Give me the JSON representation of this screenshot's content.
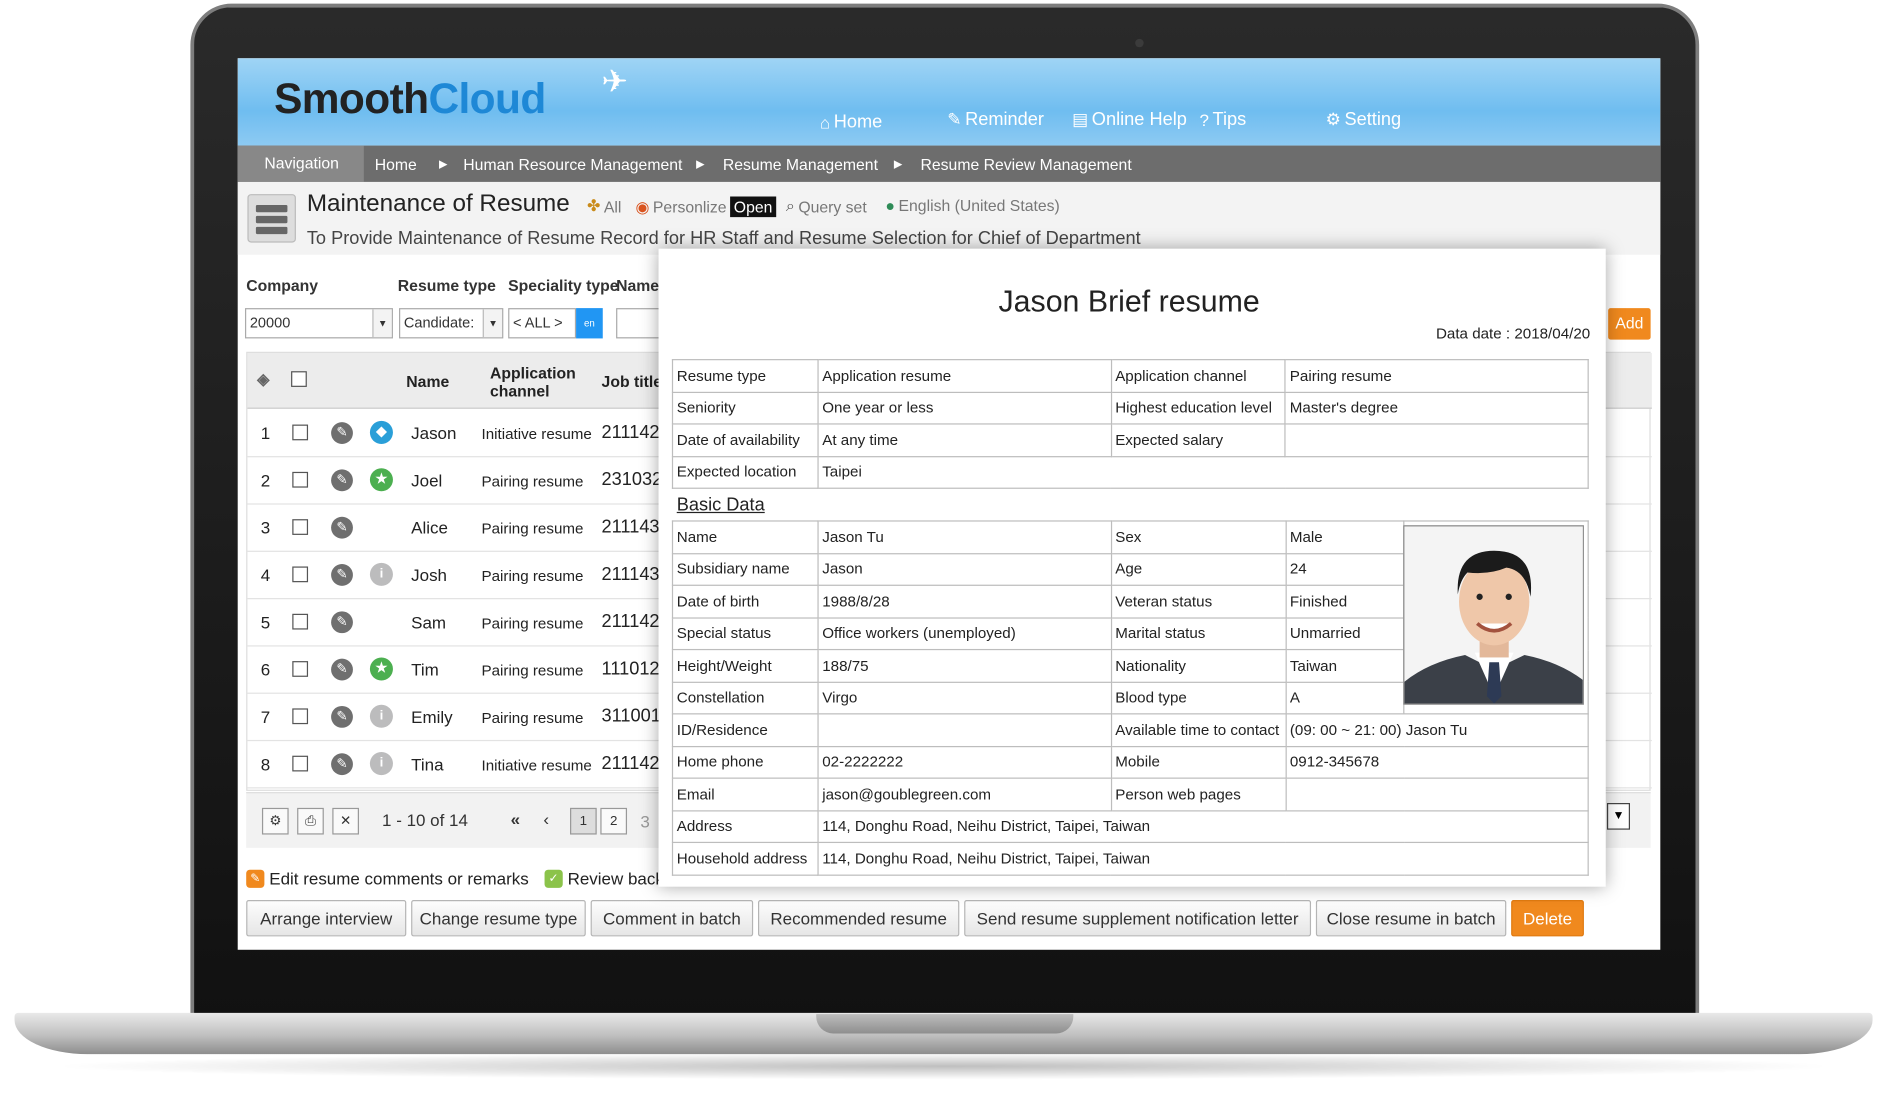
{
  "app": {
    "logo_a": "Smooth",
    "logo_b": "Cloud"
  },
  "nav": {
    "home": "Home",
    "reminder": "Reminder",
    "online_help": "Online Help",
    "tips": "Tips",
    "setting": "Setting"
  },
  "breadcrumb": {
    "navigation": "Navigation",
    "items": [
      "Home",
      "Human Resource Management",
      "Resume Management",
      "Resume Review Management"
    ]
  },
  "page": {
    "title": "Maintenance of Resume",
    "tool_all": "All",
    "tool_personalize": "Personlize",
    "tool_open": "Open",
    "tool_query": "Query set",
    "tool_lang": "English (United States)",
    "description": "To Provide Maintenance of Resume Record for HR Staff and Resume Selection for Chief of Department"
  },
  "filters": {
    "company_label": "Company",
    "company_value": "20000",
    "resume_type_label": "Resume type",
    "resume_type_value": "Candidate:",
    "speciality_label": "Speciality type",
    "speciality_value": "< ALL >",
    "en_badge": "en",
    "name_label": "Name",
    "add_label": "Add"
  },
  "grid": {
    "headers": {
      "name": "Name",
      "channel_1": "Application",
      "channel_2": "channel",
      "job_title": "Job title"
    },
    "rows": [
      {
        "num": "1",
        "name": "Jason",
        "channel": "Initiative resume",
        "job": "211142",
        "status": "tag"
      },
      {
        "num": "2",
        "name": "Joel",
        "channel": "Pairing resume",
        "job": "231032",
        "status": "star"
      },
      {
        "num": "3",
        "name": "Alice",
        "channel": "Pairing resume",
        "job": "211143",
        "status": "none"
      },
      {
        "num": "4",
        "name": "Josh",
        "channel": "Pairing resume",
        "job": "211143",
        "status": "info"
      },
      {
        "num": "5",
        "name": "Sam",
        "channel": "Pairing resume",
        "job": "211142",
        "status": "none"
      },
      {
        "num": "6",
        "name": "Tim",
        "channel": "Pairing resume",
        "job": "111012",
        "status": "star"
      },
      {
        "num": "7",
        "name": "Emily",
        "channel": "Pairing resume",
        "job": "311001",
        "status": "info"
      },
      {
        "num": "8",
        "name": "Tina",
        "channel": "Initiative resume",
        "job": "211142",
        "status": "info"
      }
    ]
  },
  "pager": {
    "range": "1 - 10 of 14",
    "page1": "1",
    "page2": "2",
    "page3": "3"
  },
  "legend": {
    "edit": "Edit resume comments or remarks",
    "review": "Review back"
  },
  "actions": {
    "arrange": "Arrange interview",
    "change": "Change resume type",
    "comment": "Comment in batch",
    "recommended": "Recommended resume",
    "supplement": "Send resume supplement notification letter",
    "close": "Close resume in batch",
    "delete": "Delete"
  },
  "resume": {
    "title": "Jason Brief resume",
    "data_date": "Data date : 2018/04/20",
    "top": [
      [
        "Resume type",
        "Application resume",
        "Application channel",
        "Pairing resume"
      ],
      [
        "Seniority",
        "One year or less",
        "Highest education level",
        "Master's degree"
      ],
      [
        "Date of availability",
        "At any time",
        "Expected salary",
        ""
      ]
    ],
    "expected_location_label": "Expected location",
    "expected_location": "Taipei",
    "basic_data": "Basic Data",
    "basic": [
      [
        "Name",
        "Jason Tu",
        "Sex",
        "Male"
      ],
      [
        "Subsidiary name",
        "Jason",
        "Age",
        "24"
      ],
      [
        "Date of birth",
        "1988/8/28",
        "Veteran status",
        "Finished"
      ],
      [
        "Special status",
        "Office workers (unemployed)",
        "Marital status",
        "Unmarried"
      ],
      [
        "Height/Weight",
        "188/75",
        "Nationality",
        "Taiwan"
      ],
      [
        "Constellation",
        "Virgo",
        "Blood type",
        "A"
      ]
    ],
    "contact": [
      [
        "ID/Residence",
        "",
        "Available time to contact",
        "(09: 00 ~ 21: 00) Jason Tu"
      ],
      [
        "Home phone",
        "02-2222222",
        "Mobile",
        "0912-345678"
      ],
      [
        "Email",
        "jason@goublegreen.com",
        "Person web pages",
        ""
      ]
    ],
    "address_label": "Address",
    "address": "114, Donghu Road, Neihu District, Taipei, Taiwan",
    "household_label": "Household address",
    "household": "114, Donghu Road, Neihu District, Taipei, Taiwan"
  },
  "colors": {
    "accent_blue": "#1e88d6",
    "orange": "#f0891e",
    "green": "#4caf50"
  }
}
